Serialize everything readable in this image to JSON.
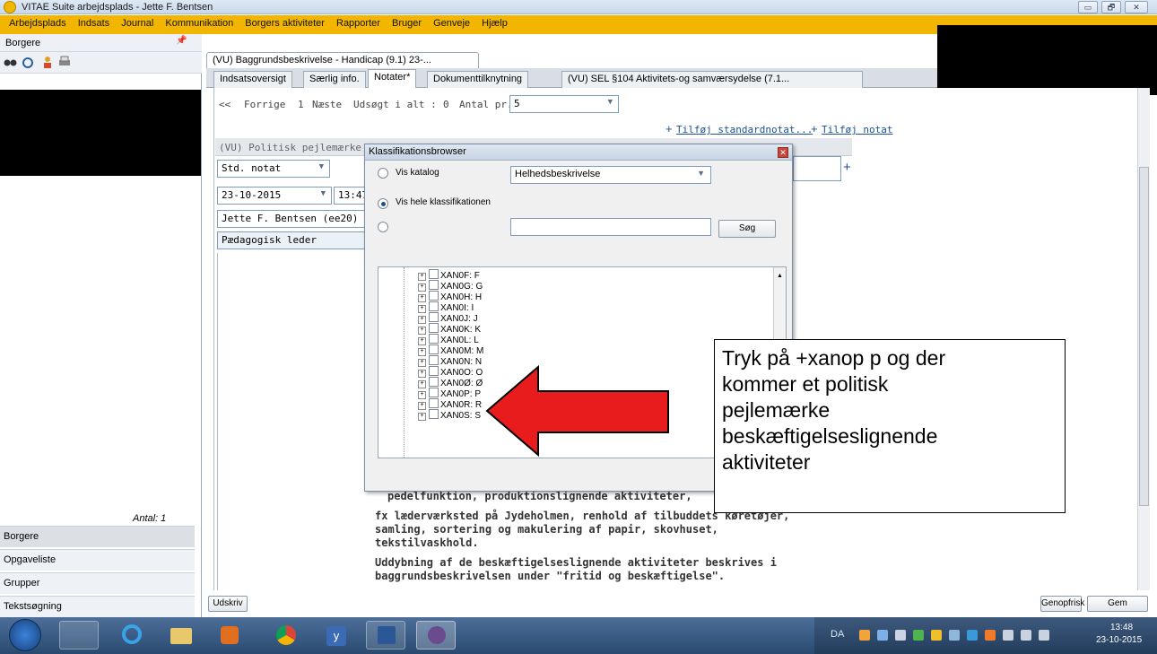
{
  "window": {
    "title": "VITAE Suite arbejdsplads - Jette F. Bentsen",
    "min": "▭",
    "max": "🗗",
    "close": "✕"
  },
  "menu": [
    "Arbejdsplads",
    "Indsats",
    "Journal",
    "Kommunikation",
    "Borgers aktiviteter",
    "Rapporter",
    "Bruger",
    "Genveje",
    "Hjælp"
  ],
  "left_panel": {
    "title": "Borgere",
    "pin": "📌",
    "count": "Antal: 1",
    "nav": [
      "Borgere",
      "Opgaveliste",
      "Grupper",
      "Tekstsøgning"
    ]
  },
  "doc_tab": "(VU) Baggrundsbeskrivelse - Handicap (9.1) 23-...",
  "tabs": [
    "Indsatsoversigt",
    "Særlig info.",
    "Notater*",
    "Dokumenttilknytning",
    "(VU) SEL §104 Aktivitets-og samværsydelse (7.1..."
  ],
  "pager": {
    "prev_arrows": "<<",
    "prev": "Forrige",
    "page": "1",
    "next": "Næste",
    "found_label": "Udsøgt i alt :",
    "found": "0",
    "per_page_label": "Antal pr. side",
    "per_page": "5"
  },
  "links": {
    "standard": "Tilføj standardnotat...",
    "note": "Tilføj notat",
    "plus": "+"
  },
  "note": {
    "header": "(VU) Politisk pejlemærke om",
    "type": "Std. notat",
    "date": "23-10-2015",
    "time": "13:47",
    "author": "Jette F. Bentsen (ee20)",
    "role": "Pædagogisk leder",
    "plus": "+"
  },
  "body_text": [
    "pedelfunktion, produktionslignende aktiviteter,",
    "fx læderværksted på Jydeholmen, renhold af tilbuddets køretøjer,",
    "samling, sortering og makulering af papir, skovhuset,",
    "tekstilvaskhold.",
    "Uddybning af de beskæftigelseslignende aktiviteter beskrives i",
    "baggrundsbeskrivelsen under \"fritid og beskæftigelse\"."
  ],
  "dialog": {
    "title": "Klassifikationsbrowser",
    "close": "✕",
    "opt_catalog": "Vis katalog",
    "catalog_value": "Helhedsbeskrivelse",
    "opt_all": "Vis hele klassifikationen",
    "search_value": "",
    "search_btn": "Søg",
    "tree": [
      "XAN0F: F",
      "XAN0G: G",
      "XAN0H: H",
      "XAN0I: I",
      "XAN0J: J",
      "XAN0K: K",
      "XAN0L: L",
      "XAN0M: M",
      "XAN0N: N",
      "XAN0O: O",
      "XAN0Ø: Ø",
      "XAN0P: P",
      "XAN0R: R",
      "XAN0S: S"
    ]
  },
  "callout": [
    "Tryk på +xanop p og der",
    "kommer et politisk",
    "pejlemærke",
    "beskæftigelseslignende",
    "aktiviteter"
  ],
  "buttons": {
    "print": "Udskriv",
    "refresh": "Genopfrisk",
    "save": "Gem"
  },
  "tray": {
    "lang": "DA",
    "time": "13:48",
    "date": "23-10-2015"
  },
  "colors": {
    "menu": "#f2b600",
    "arrow": "#e81c1c",
    "taskbar": "#3a5b84"
  }
}
